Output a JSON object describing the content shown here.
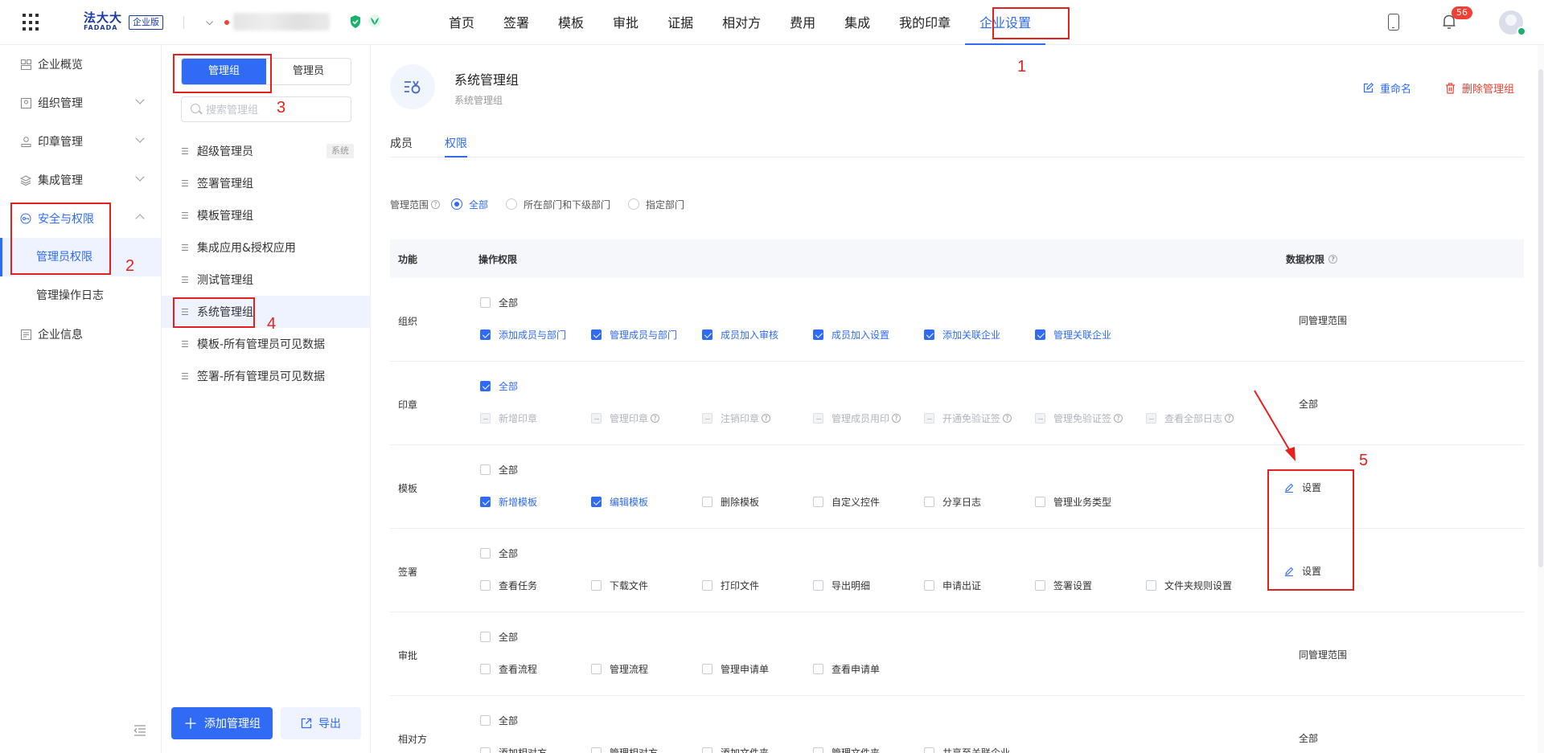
{
  "topbar": {
    "logo_cn": "法大大",
    "logo_en": "FADADA",
    "edition": "企业版",
    "nav": [
      "首页",
      "签署",
      "模板",
      "审批",
      "证据",
      "相对方",
      "费用",
      "集成",
      "我的印章",
      "企业设置"
    ],
    "notification_count": "56"
  },
  "leftnav": {
    "items": [
      "企业概览",
      "组织管理",
      "印章管理",
      "集成管理",
      "安全与权限"
    ],
    "sub_items": [
      "管理员权限",
      "管理操作日志"
    ],
    "last_item": "企业信息"
  },
  "groups": {
    "seg_labels": [
      "管理组",
      "管理员"
    ],
    "search_placeholder": "搜索管理组",
    "list": [
      "超级管理员",
      "签署管理组",
      "模板管理组",
      "集成应用&授权应用",
      "测试管理组",
      "系统管理组",
      "模板-所有管理员可见数据",
      "签署-所有管理员可见数据"
    ],
    "system_tag": "系统",
    "add_button": "添加管理组",
    "export_button": "导出"
  },
  "detail": {
    "title": "系统管理组",
    "subtitle": "系统管理组",
    "rename": "重命名",
    "delete": "删除管理组",
    "tabs": [
      "成员",
      "权限"
    ],
    "scope_label": "管理范围",
    "scope_options": [
      "全部",
      "所在部门和下级部门",
      "指定部门"
    ],
    "columns": [
      "功能",
      "操作权限",
      "数据权限"
    ],
    "all_label": "全部",
    "rows": [
      {
        "label": "组织",
        "all": false,
        "items": [
          [
            "添加成员与部门",
            true
          ],
          [
            "管理成员与部门",
            true
          ],
          [
            "成员加入审核",
            true
          ],
          [
            "成员加入设置",
            true
          ],
          [
            "添加关联企业",
            true
          ],
          [
            "管理关联企业",
            true
          ]
        ],
        "data": "同管理范围"
      },
      {
        "label": "印章",
        "all": true,
        "items": [
          [
            "新增印章",
            false
          ],
          [
            "管理印章",
            false
          ],
          [
            "注销印章",
            false
          ],
          [
            "管理成员用印",
            false
          ],
          [
            "开通免验证签",
            false
          ],
          [
            "管理免验证签",
            false
          ],
          [
            "查看全部日志",
            false
          ]
        ],
        "data": "全部"
      },
      {
        "label": "模板",
        "all": false,
        "items": [
          [
            "新增模板",
            true
          ],
          [
            "编辑模板",
            true
          ],
          [
            "删除模板",
            false
          ],
          [
            "自定义控件",
            false
          ],
          [
            "分享日志",
            false
          ],
          [
            "管理业务类型",
            false
          ]
        ],
        "data": "设置"
      },
      {
        "label": "签署",
        "all": false,
        "items": [
          [
            "查看任务",
            false
          ],
          [
            "下载文件",
            false
          ],
          [
            "打印文件",
            false
          ],
          [
            "导出明细",
            false
          ],
          [
            "申请出证",
            false
          ],
          [
            "签署设置",
            false
          ],
          [
            "文件夹规则设置",
            false
          ]
        ],
        "data": "设置"
      },
      {
        "label": "审批",
        "all": false,
        "items": [
          [
            "查看流程",
            false
          ],
          [
            "管理流程",
            false
          ],
          [
            "管理申请单",
            false
          ],
          [
            "查看申请单",
            false
          ]
        ],
        "data": "同管理范围"
      },
      {
        "label": "相对方",
        "all": false,
        "items": [
          [
            "添加相对方",
            false
          ],
          [
            "管理相对方",
            false
          ],
          [
            "添加文件夹",
            false
          ],
          [
            "管理文件夹",
            false
          ],
          [
            "共享至关联企业",
            false
          ]
        ],
        "data": "全部"
      }
    ]
  },
  "annotations": [
    "1",
    "2",
    "3",
    "4",
    "5"
  ],
  "colors": {
    "primary": "#2f6bf5",
    "annotation": "#e5211f",
    "danger": "#f04134"
  }
}
